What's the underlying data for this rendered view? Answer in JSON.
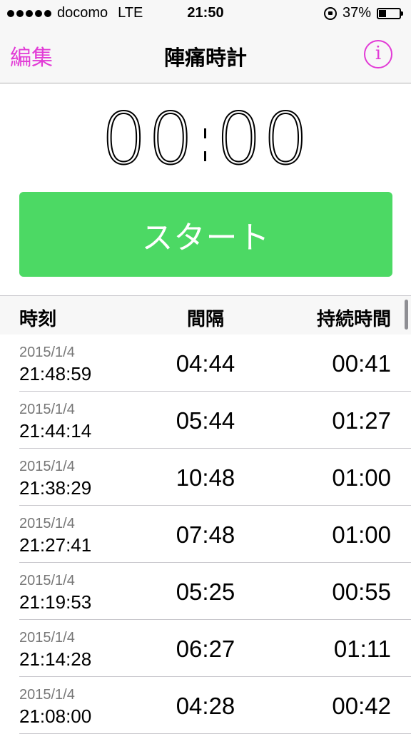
{
  "status_bar": {
    "carrier": "docomo",
    "network": "LTE",
    "time": "21:50",
    "battery_percent": "37%",
    "battery_level": 0.37
  },
  "nav": {
    "edit_label": "編集",
    "title": "陣痛時計",
    "info_label": "i"
  },
  "timer": {
    "minutes": "00",
    "seconds": "00"
  },
  "start_button": {
    "label": "スタート"
  },
  "table": {
    "headers": {
      "time": "時刻",
      "interval": "間隔",
      "duration": "持続時間"
    },
    "rows": [
      {
        "date": "2015/1/4",
        "time": "21:48:59",
        "interval": "04:44",
        "duration": "00:41"
      },
      {
        "date": "2015/1/4",
        "time": "21:44:14",
        "interval": "05:44",
        "duration": "01:27"
      },
      {
        "date": "2015/1/4",
        "time": "21:38:29",
        "interval": "10:48",
        "duration": "01:00"
      },
      {
        "date": "2015/1/4",
        "time": "21:27:41",
        "interval": "07:48",
        "duration": "01:00"
      },
      {
        "date": "2015/1/4",
        "time": "21:19:53",
        "interval": "05:25",
        "duration": "00:55"
      },
      {
        "date": "2015/1/4",
        "time": "21:14:28",
        "interval": "06:27",
        "duration": "01:11"
      },
      {
        "date": "2015/1/4",
        "time": "21:08:00",
        "interval": "04:28",
        "duration": "00:42"
      }
    ]
  },
  "colors": {
    "accent": "#e23bd6",
    "start_green": "#4cd964"
  }
}
